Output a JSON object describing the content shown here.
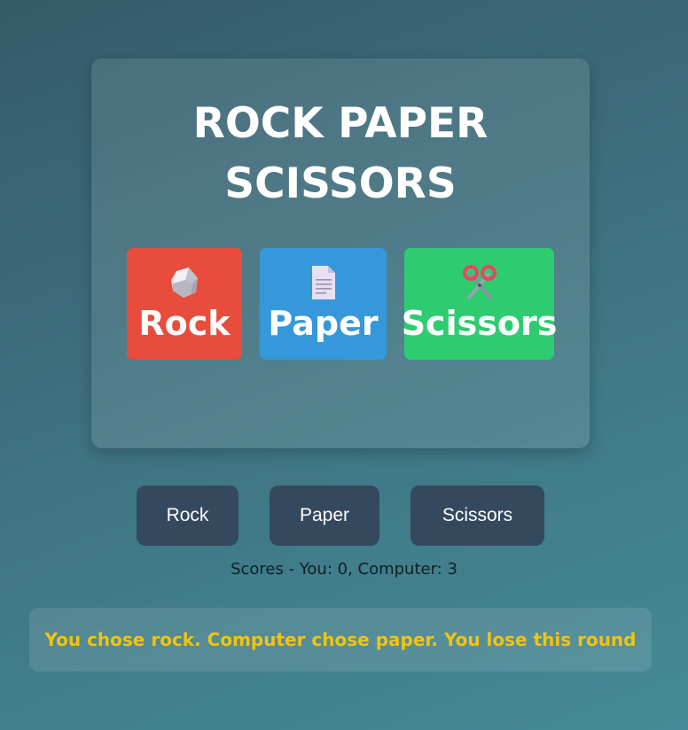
{
  "title_line1": "ROCK PAPER",
  "title_line2": "SCISSORS",
  "choices": [
    {
      "label": "Rock",
      "icon": "rock-icon",
      "color": "#e74c3c"
    },
    {
      "label": "Paper",
      "icon": "paper-icon",
      "color": "#3498db"
    },
    {
      "label": "Scissors",
      "icon": "scissors-icon",
      "color": "#2ecc71"
    }
  ],
  "buttons": {
    "rock": "Rock",
    "paper": "Paper",
    "scissors": "Scissors"
  },
  "scores_text": "Scores - You: 0, Computer: 3",
  "result_text": "You chose rock. Computer chose paper. You lose this round",
  "colors": {
    "button_bg": "#34495e",
    "result_text": "#f1c40f"
  }
}
